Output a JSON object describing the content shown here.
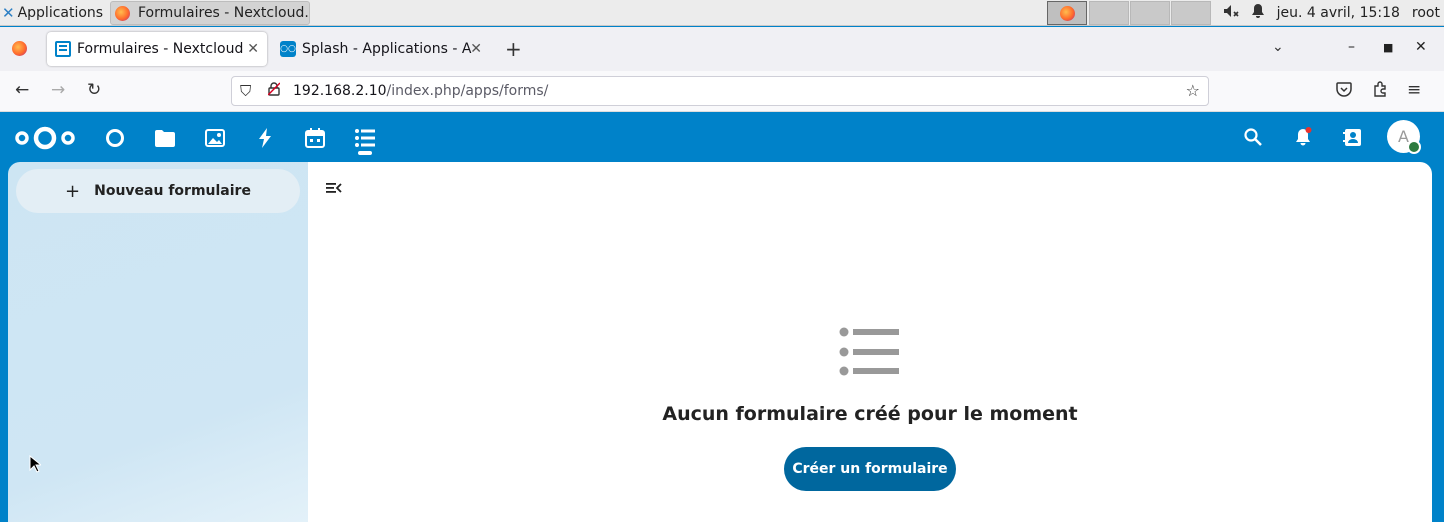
{
  "panel": {
    "applications_label": "Applications",
    "task_title": "Formulaires - Nextcloud...",
    "datetime": "jeu.  4 avril, 15:18",
    "user": "root"
  },
  "browser": {
    "tabs": [
      {
        "title": "Formulaires - Nextcloud",
        "active": true
      },
      {
        "title": "Splash - Applications - Ap",
        "active": false
      }
    ],
    "url_host": "192.168.2.10",
    "url_path": "/index.php/apps/forms/"
  },
  "nextcloud": {
    "avatar_initial": "A",
    "nav": {
      "new_form_label": "Nouveau formulaire"
    },
    "empty": {
      "title": "Aucun formulaire créé pour le moment",
      "create_label": "Créer un formulaire"
    }
  },
  "colors": {
    "brand": "#0082c9",
    "primary_button": "#00679e"
  }
}
